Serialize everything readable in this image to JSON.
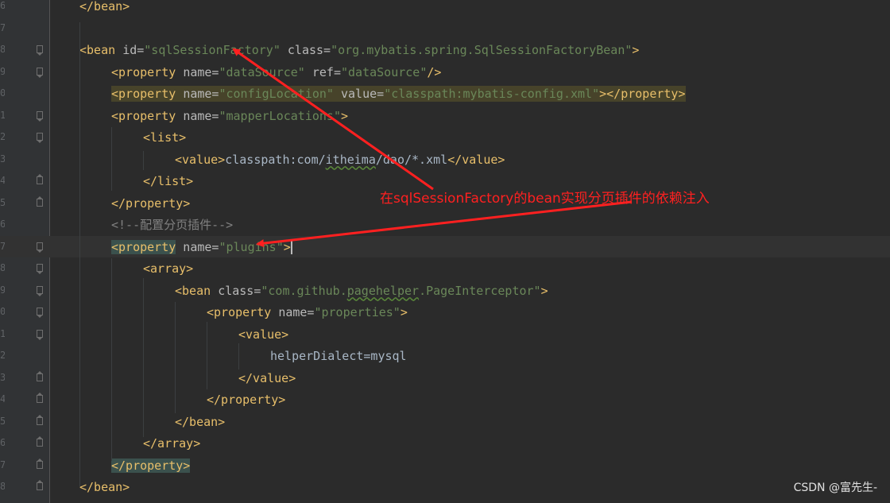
{
  "editor": {
    "line_numbers": [
      "6",
      "7",
      "8",
      "9",
      "0",
      "1",
      "2",
      "3",
      "4",
      "5",
      "6",
      "7",
      "8",
      "9",
      "0",
      "1",
      "2",
      "3",
      "4",
      "5",
      "6",
      "7",
      "8"
    ],
    "lines": [
      {
        "segments": [
          {
            "t": "tag",
            "v": "</bean>"
          }
        ]
      },
      {
        "segments": []
      },
      {
        "segments": [
          {
            "t": "tag",
            "v": "<bean "
          },
          {
            "t": "attr",
            "v": "id="
          },
          {
            "t": "val",
            "v": "\"sqlSessionFactory\""
          },
          {
            "t": "attr",
            "v": " class="
          },
          {
            "t": "val",
            "v": "\"org.mybatis.spring.SqlSessionFactoryBean\""
          },
          {
            "t": "tag",
            "v": ">"
          }
        ]
      },
      {
        "segments": [
          {
            "t": "tag",
            "v": "<property "
          },
          {
            "t": "attr",
            "v": "name="
          },
          {
            "t": "val",
            "v": "\"dataSource\""
          },
          {
            "t": "attr",
            "v": " ref="
          },
          {
            "t": "val",
            "v": "\"dataSource\""
          },
          {
            "t": "tag",
            "v": "/>"
          }
        ]
      },
      {
        "segments": [
          {
            "t": "tag",
            "v": "<property "
          },
          {
            "t": "attr",
            "v": "name="
          },
          {
            "t": "val",
            "v": "\"configLocation\""
          },
          {
            "t": "attr",
            "v": " value="
          },
          {
            "t": "val",
            "v": "\"classpath:mybatis-config.xml\""
          },
          {
            "t": "tag",
            "v": "></property>"
          }
        ]
      },
      {
        "segments": [
          {
            "t": "tag",
            "v": "<property "
          },
          {
            "t": "attr",
            "v": "name="
          },
          {
            "t": "val",
            "v": "\"mapperLocations\""
          },
          {
            "t": "tag",
            "v": ">"
          }
        ]
      },
      {
        "segments": [
          {
            "t": "tag",
            "v": "<list>"
          }
        ]
      },
      {
        "segments": [
          {
            "t": "tag",
            "v": "<value>"
          },
          {
            "t": "txt",
            "v": "classpath:com/"
          },
          {
            "t": "txtu",
            "v": "itheima"
          },
          {
            "t": "txt",
            "v": "/dao/*.xml"
          },
          {
            "t": "tag",
            "v": "</value>"
          }
        ]
      },
      {
        "segments": [
          {
            "t": "tag",
            "v": "</list>"
          }
        ]
      },
      {
        "segments": [
          {
            "t": "tag",
            "v": "</property>"
          }
        ]
      },
      {
        "segments": [
          {
            "t": "cmt",
            "v": "<!--配置分页插件-->"
          }
        ]
      },
      {
        "segments": [
          {
            "t": "taghl",
            "v": "<property"
          },
          {
            "t": "attr",
            "v": " name="
          },
          {
            "t": "val",
            "v": "\"plugins\""
          },
          {
            "t": "tag",
            "v": ">"
          }
        ]
      },
      {
        "segments": [
          {
            "t": "tag",
            "v": "<array>"
          }
        ]
      },
      {
        "segments": [
          {
            "t": "tag",
            "v": "<bean "
          },
          {
            "t": "attr",
            "v": "class="
          },
          {
            "t": "val",
            "v": "\"com.github."
          },
          {
            "t": "valu",
            "v": "pagehelper"
          },
          {
            "t": "val",
            "v": ".PageInterceptor\""
          },
          {
            "t": "tag",
            "v": ">"
          }
        ]
      },
      {
        "segments": [
          {
            "t": "tag",
            "v": "<property "
          },
          {
            "t": "attr",
            "v": "name="
          },
          {
            "t": "val",
            "v": "\"properties\""
          },
          {
            "t": "tag",
            "v": ">"
          }
        ]
      },
      {
        "segments": [
          {
            "t": "tag",
            "v": "<value>"
          }
        ]
      },
      {
        "segments": [
          {
            "t": "txt",
            "v": "helperDialect=mysql"
          }
        ]
      },
      {
        "segments": [
          {
            "t": "tag",
            "v": "</value>"
          }
        ]
      },
      {
        "segments": [
          {
            "t": "tag",
            "v": "</property>"
          }
        ]
      },
      {
        "segments": [
          {
            "t": "tag",
            "v": "</bean>"
          }
        ]
      },
      {
        "segments": [
          {
            "t": "tag",
            "v": "</array>"
          }
        ]
      },
      {
        "segments": [
          {
            "t": "taghl",
            "v": "</property>"
          }
        ]
      },
      {
        "segments": [
          {
            "t": "tag",
            "v": "</bean>"
          }
        ]
      }
    ]
  },
  "annotation": {
    "text": "在sqlSessionFactory的bean实现分页插件的依赖注入",
    "color": "#ff2020"
  },
  "watermark": "CSDN @富先生-",
  "colors": {
    "background": "#2b2b2b",
    "tag": "#e8bf6a",
    "attribute": "#bababa",
    "value": "#6a8759",
    "comment": "#808080"
  }
}
